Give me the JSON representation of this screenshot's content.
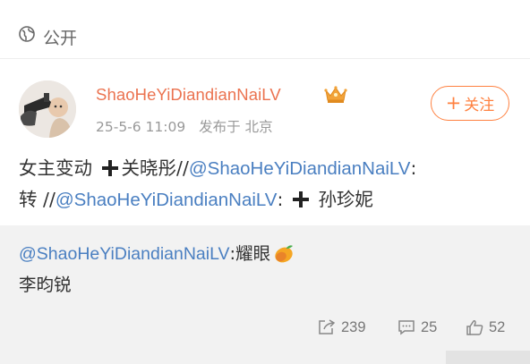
{
  "visibility": {
    "label": "公开",
    "icon": "globe-icon"
  },
  "post": {
    "username": "ShaoHeYiDiandianNaiLV",
    "badge_icon": "crown-icon",
    "date": "25-5-6 11:09",
    "published_from": "发布于 北京",
    "follow_label": "关注",
    "content": {
      "line1_text": "女主变动",
      "line1_name": "关晓彤",
      "line1_sep": "//",
      "mention": "@ShaoHeYiDiandianNaiLV",
      "colon": ":",
      "line2_prefix": "转",
      "line2_name": "孙珍妮"
    }
  },
  "retweet": {
    "mention": "@ShaoHeYiDiandianNaiLV",
    "text": ":耀眼",
    "emoji": "mango-icon",
    "name": "李昀锐"
  },
  "actions": {
    "forward_count": "239",
    "comment_count": "25",
    "like_count": "52"
  },
  "colors": {
    "username": "#eb7350",
    "mention": "#4a7fc1",
    "follow": "#ff8140",
    "retweet_bg": "#f2f2f2"
  }
}
